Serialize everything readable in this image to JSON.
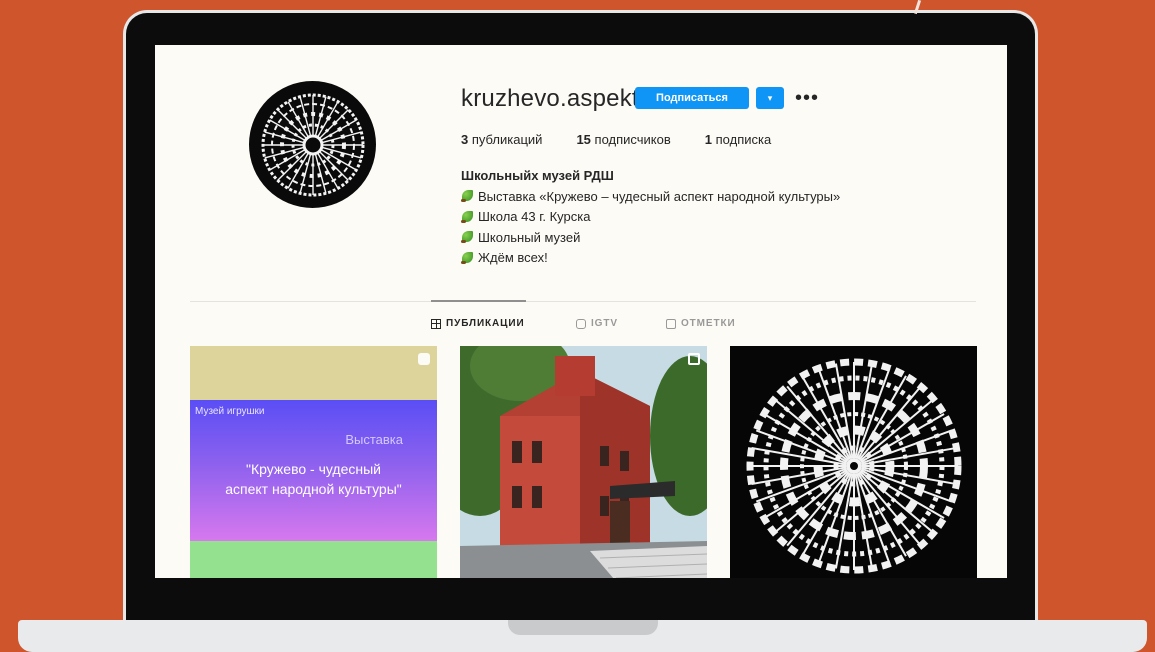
{
  "profile": {
    "username": "kruzhevo.aspekt",
    "follow_label": "Подписаться",
    "dropdown_glyph": "▾",
    "more_glyph": "•••",
    "stats": [
      {
        "count": "3",
        "label": "публикаций"
      },
      {
        "count": "15",
        "label": "подписчиков"
      },
      {
        "count": "1",
        "label": "подписка"
      }
    ],
    "bio": {
      "name": "Школьныйх музей РДШ",
      "lines": [
        "Выставка «Кружево – чудесный аспект народной культуры»",
        "Школа 43 г. Курска",
        "Школьный музей",
        "Ждём всех!"
      ],
      "line_icon": "green-leaf-icon"
    }
  },
  "tabs": [
    {
      "label": "ПУБЛИКАЦИИ",
      "icon": "grid-icon",
      "active": true
    },
    {
      "label": "IGTV",
      "icon": "igtv-icon",
      "active": false
    },
    {
      "label": "ОТМЕТКИ",
      "icon": "tag-icon",
      "active": false
    }
  ],
  "posts": [
    {
      "kind": "text-card",
      "small_text": "Музей игрушки",
      "mid_text": "Выставка",
      "title_line1": "\"Кружево - чудесный",
      "title_line2": "аспект народной культуры\""
    },
    {
      "kind": "photo",
      "subject": "red-brick-building"
    },
    {
      "kind": "photo",
      "subject": "white-lace-doily"
    }
  ],
  "colors": {
    "background": "#cf552d",
    "accent": "#0f95f6",
    "screen": "#fdfbf6"
  }
}
